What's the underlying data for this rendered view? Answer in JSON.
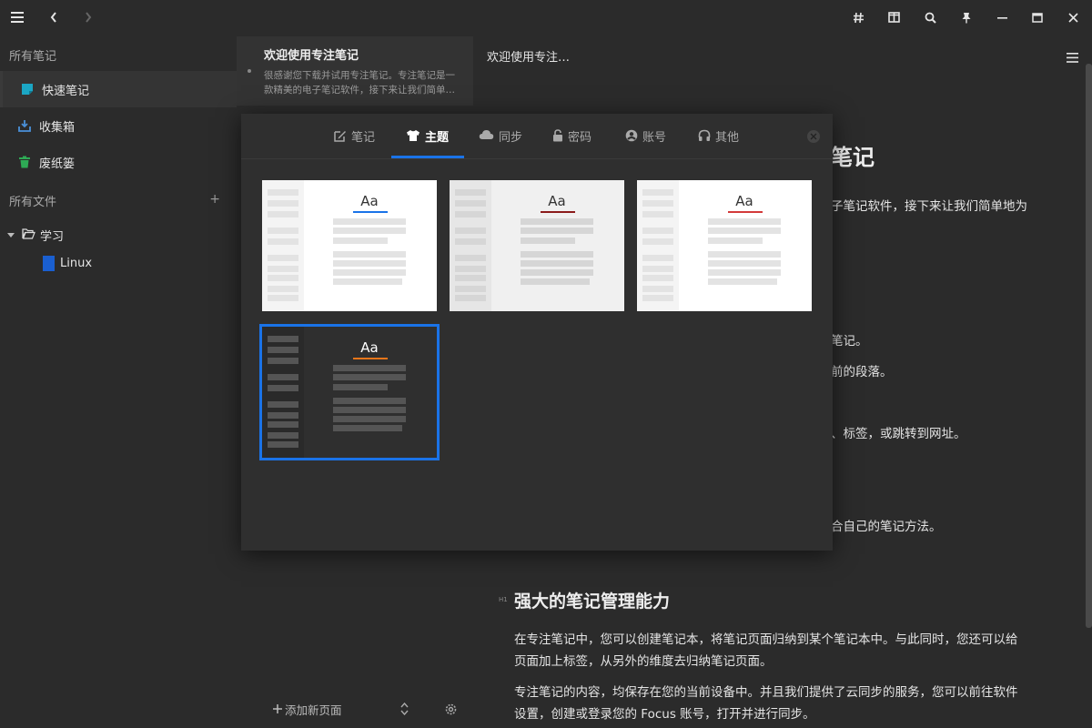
{
  "sidebar": {
    "all_notes": "所有笔记",
    "items": [
      {
        "label": "快速笔记",
        "icon": "quick-note-icon",
        "color": "#1ba6c4"
      },
      {
        "label": "收集箱",
        "icon": "inbox-icon",
        "color": "#4a90d9"
      },
      {
        "label": "废纸篓",
        "icon": "trash-icon",
        "color": "#2eaa55"
      }
    ],
    "all_files": "所有文件",
    "add_symbol": "+",
    "folder": {
      "label": "学习"
    },
    "notebook": {
      "label": "Linux",
      "color": "#1a5fd0"
    }
  },
  "notelist": {
    "note": {
      "title": "欢迎使用专注笔记",
      "snippet": "很感谢您下载并试用专注笔记。专注笔记是一款精美的电子笔记软件，接下来让我们简单…"
    },
    "add_page": "添加新页面"
  },
  "editor": {
    "title": "欢迎使用专注…",
    "fragments": {
      "heading_tail": "笔记",
      "p1_tail": "子笔记软件，接下来让我们简单地为",
      "p2_tail": "笔记。",
      "p3_tail": "前的段落。",
      "p4_tail": "、标签，或跳转到网址。",
      "p5_tail": "合自己的笔记方法。"
    },
    "h1_marker": "H1",
    "heading2": "强大的笔记管理能力",
    "para1_line1": "在专注笔记中，您可以创建笔记本，将笔记页面归纳到某个笔记本中。与此同时，您还可以给",
    "para1_line2": "页面加上标签，从另外的维度去归纳笔记页面。",
    "para2_line1": "专注笔记的内容，均保存在您的当前设备中。并且我们提供了云同步的服务，您可以前往软件",
    "para2_line2": "设置，创建或登录您的 Focus 账号，打开并进行同步。"
  },
  "settings_modal": {
    "tabs": [
      {
        "label": "笔记",
        "icon": "edit-icon"
      },
      {
        "label": "主题",
        "icon": "shirt-icon"
      },
      {
        "label": "同步",
        "icon": "cloud-icon"
      },
      {
        "label": "密码",
        "icon": "lock-icon"
      },
      {
        "label": "账号",
        "icon": "user-circle-icon"
      },
      {
        "label": "其他",
        "icon": "headphones-icon"
      }
    ],
    "active_tab": "主题",
    "preview_text": "Aa",
    "themes": [
      {
        "bg": "#ffffff",
        "side": "#f4f4f4",
        "line": "#e3e3e3",
        "text": "#333333",
        "accent": "#1a73e8",
        "selected": false
      },
      {
        "bg": "#f0f0f0",
        "side": "#e6e6e6",
        "line": "#d6d6d6",
        "text": "#333333",
        "accent": "#8b1a1a",
        "selected": false
      },
      {
        "bg": "#ffffff",
        "side": "#f4f4f4",
        "line": "#e3e3e3",
        "text": "#333333",
        "accent": "#d33a3a",
        "selected": false
      },
      {
        "bg": "#2f2f2f",
        "side": "#2a2a2a",
        "line": "#555555",
        "text": "#ffffff",
        "accent": "#e8761a",
        "selected": true
      }
    ]
  },
  "colors": {
    "accent": "#1a73e8",
    "background": "#2b2b2b"
  }
}
